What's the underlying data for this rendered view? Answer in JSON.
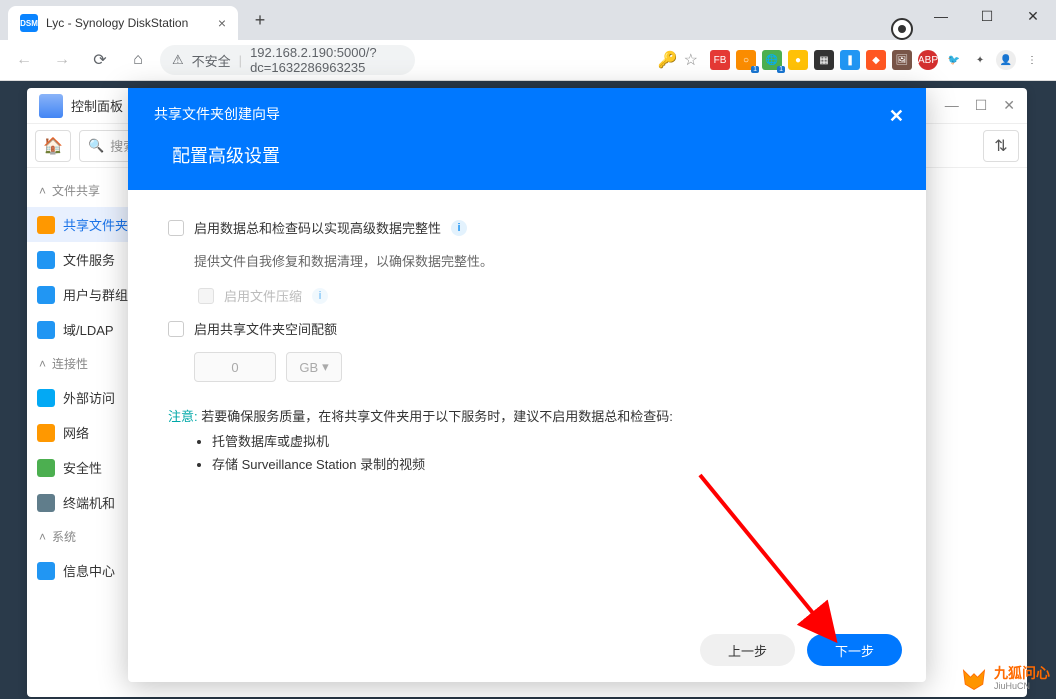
{
  "browser": {
    "tab_title": "Lyc - Synology DiskStation",
    "url_prefix": "不安全",
    "url": "192.168.2.190:5000/?dc=1632286963235"
  },
  "dsm_window": {
    "title": "控制面板",
    "search_placeholder": "搜索"
  },
  "sidebar": {
    "sections": {
      "file_sharing": "文件共享",
      "connectivity": "连接性",
      "system": "系统"
    },
    "items": {
      "shared_folder": "共享文件夹",
      "file_services": "文件服务",
      "user_group": "用户与群组",
      "domain_ldap": "域/LDAP",
      "external_access": "外部访问",
      "network": "网络",
      "security": "安全性",
      "terminal": "终端机和",
      "info_center": "信息中心"
    }
  },
  "modal": {
    "title": "共享文件夹创建向导",
    "subtitle": "配置高级设置",
    "opt_checksum": "启用数据总和检查码以实现高级数据完整性",
    "desc_checksum": "提供文件自我修复和数据清理，以确保数据完整性。",
    "opt_compression": "启用文件压缩",
    "opt_quota": "启用共享文件夹空间配额",
    "quota_value": "0",
    "quota_unit": "GB",
    "note_label": "注意:",
    "note_text": "若要确保服务质量，在将共享文件夹用于以下服务时，建议不启用数据总和检查码:",
    "note_item1": "托管数据库或虚拟机",
    "note_item2": "存储 Surveillance Station 录制的视频",
    "btn_prev": "上一步",
    "btn_next": "下一步"
  },
  "watermark": {
    "cn": "九狐问心",
    "en": "JiuHuCN"
  }
}
